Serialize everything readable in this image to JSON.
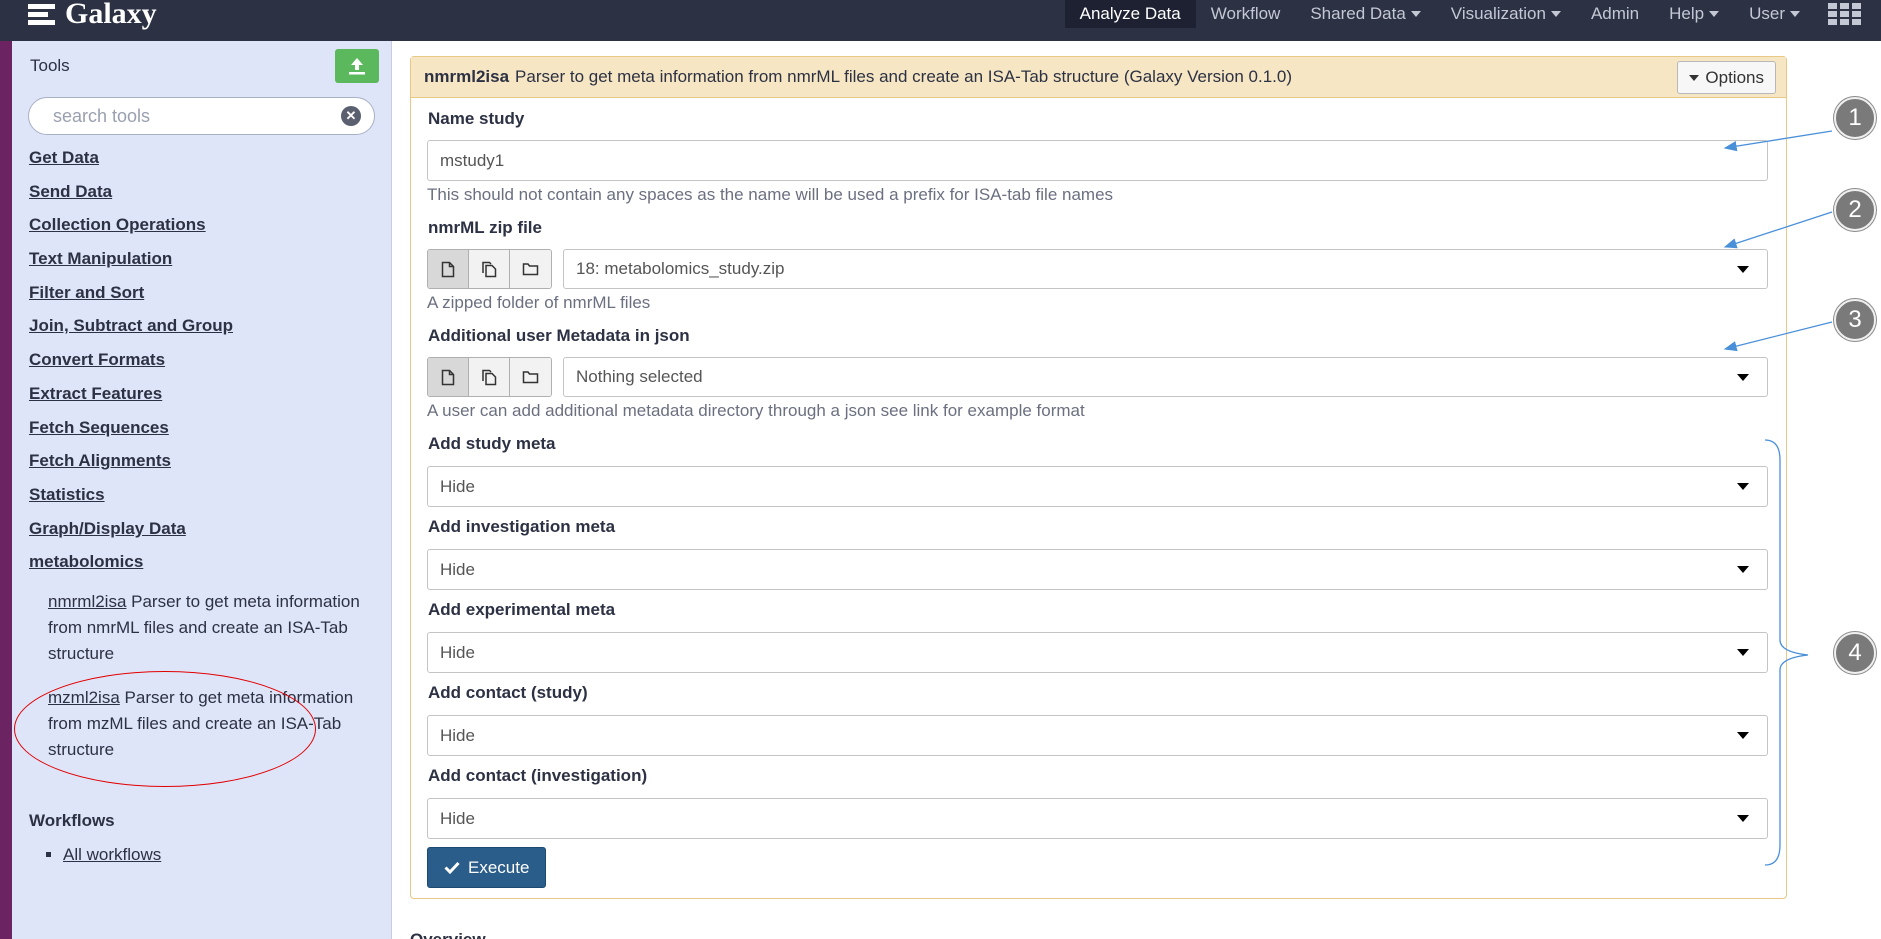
{
  "navbar": {
    "brand": "Galaxy",
    "items": [
      {
        "label": "Analyze Data",
        "active": true,
        "dropdown": false
      },
      {
        "label": "Workflow",
        "active": false,
        "dropdown": false
      },
      {
        "label": "Shared Data",
        "active": false,
        "dropdown": true
      },
      {
        "label": "Visualization",
        "active": false,
        "dropdown": true
      },
      {
        "label": "Admin",
        "active": false,
        "dropdown": false
      },
      {
        "label": "Help",
        "active": false,
        "dropdown": true
      },
      {
        "label": "User",
        "active": false,
        "dropdown": true
      }
    ]
  },
  "tools": {
    "title": "Tools",
    "search_placeholder": "search tools",
    "sections": [
      "Get Data",
      "Send Data",
      "Collection Operations",
      "Text Manipulation",
      "Filter and Sort",
      "Join, Subtract and Group",
      "Convert Formats",
      "Extract Features",
      "Fetch Sequences",
      "Fetch Alignments",
      "Statistics",
      "Graph/Display Data",
      "metabolomics"
    ],
    "entries": [
      {
        "name": "nmrml2isa",
        "description": "Parser to get meta information from nmrML files and create an ISA-Tab structure"
      },
      {
        "name": "mzml2isa",
        "description": "Parser to get meta information from mzML files and create an ISA-Tab structure"
      }
    ],
    "workflows_title": "Workflows",
    "workflows_link": "All workflows"
  },
  "form": {
    "tool_name": "nmrml2isa",
    "tool_description": "Parser to get meta information from nmrML files and create an ISA-Tab structure (Galaxy Version 0.1.0)",
    "options_label": "Options",
    "name_study": {
      "label": "Name study",
      "value": "mstudy1",
      "help": "This should not contain any spaces as the name will be used a prefix for ISA-tab file names"
    },
    "zip_file": {
      "label": "nmrML zip file",
      "value": "18: metabolomics_study.zip",
      "help": "A zipped folder of nmrML files"
    },
    "json_meta": {
      "label": "Additional user Metadata in json",
      "value": "Nothing selected",
      "help": "A user can add additional metadata directory through a json see link for example format"
    },
    "selects": [
      {
        "label": "Add study meta",
        "value": "Hide"
      },
      {
        "label": "Add investigation meta",
        "value": "Hide"
      },
      {
        "label": "Add experimental meta",
        "value": "Hide"
      },
      {
        "label": "Add contact (study)",
        "value": "Hide"
      },
      {
        "label": "Add contact (investigation)",
        "value": "Hide"
      }
    ],
    "execute_label": "Execute"
  },
  "overview_heading": "Overview",
  "callouts": [
    "1",
    "2",
    "3",
    "4"
  ],
  "colors": {
    "navbar": "#2c3143",
    "tool_panel": "#dfe5f9",
    "form_header": "#f6e6c3",
    "execute": "#2a5d8a",
    "upload": "#5cb85c",
    "highlight_ellipse": "#e00000",
    "annotation_arrow": "#4a90d9"
  }
}
